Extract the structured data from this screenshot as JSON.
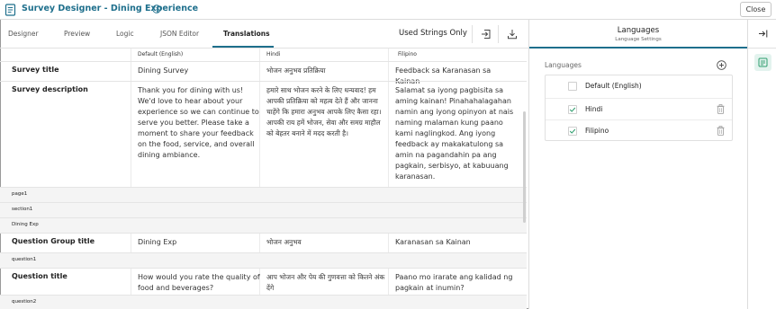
{
  "window": {
    "title": "Survey Designer - Dining Experience",
    "close_label": "Close"
  },
  "tabs": [
    {
      "label": "Designer"
    },
    {
      "label": "Preview"
    },
    {
      "label": "Logic"
    },
    {
      "label": "JSON Editor"
    },
    {
      "label": "Translations",
      "active": true
    }
  ],
  "toolbar": {
    "used_strings_label": "Used Strings Only"
  },
  "grid": {
    "columns": [
      "Default (English)",
      "Hindi",
      "Filipino"
    ],
    "rows": [
      {
        "type": "field",
        "label": "Survey title",
        "en": "Dining Survey",
        "hi": "भोजन अनुभव प्रतिक्रिया",
        "fi": "Feedback sa Karanasan sa Kainan"
      },
      {
        "type": "field",
        "label": "Survey description",
        "en": "Thank you for dining with us! We'd love to hear about your experience so we can continue to serve you better. Please take a moment to share your feedback on the food, service, and overall dining ambiance.",
        "hi": "हमारे साथ भोजन करने के लिए धन्यवाद! हम आपकी प्रतिक्रिया को महत्व देते हैं और जानना चाहेंगे कि हमारा अनुभव आपके लिए कैसा रहा। आपकी राय हमें भोजन, सेवा और समग्र माहौल को बेहतर बनाने में मदद करती है।",
        "fi": "Salamat sa iyong pagbisita sa aming kainan! Pinahahalagahan namin ang iyong opinyon at nais naming malaman kung paano kami naglingkod. Ang iyong feedback ay makakatulong sa amin na pagandahin pa ang pagkain, serbisyo, at kabuuang karanasan."
      },
      {
        "type": "section",
        "label": "page1"
      },
      {
        "type": "section",
        "label": "section1"
      },
      {
        "type": "section",
        "label": "Dining Exp"
      },
      {
        "type": "field",
        "label": "Question Group title",
        "en": "Dining Exp",
        "hi": "भोजन अनुभव",
        "fi": "Karanasan sa Kainan"
      },
      {
        "type": "section",
        "label": "question1"
      },
      {
        "type": "field",
        "label": "Question title",
        "en": "How would you rate the quality of food and beverages?",
        "hi": "आप भोजन और पेय की गुणवत्ता को कितने अंक देंगे",
        "fi": "Paano mo irarate ang kalidad ng pagkain at inumin?"
      },
      {
        "type": "section",
        "label": "question2"
      }
    ]
  },
  "languages_panel": {
    "title": "Languages",
    "subtitle": "Language Settings",
    "section_label": "Languages",
    "items": [
      {
        "name": "Default (English)",
        "checked": false,
        "deletable": false
      },
      {
        "name": "Hindi",
        "checked": true,
        "deletable": true
      },
      {
        "name": "Filipino",
        "checked": true,
        "deletable": true
      }
    ]
  },
  "colors": {
    "accent": "#1e6f8c",
    "check": "#2e9e6e"
  }
}
